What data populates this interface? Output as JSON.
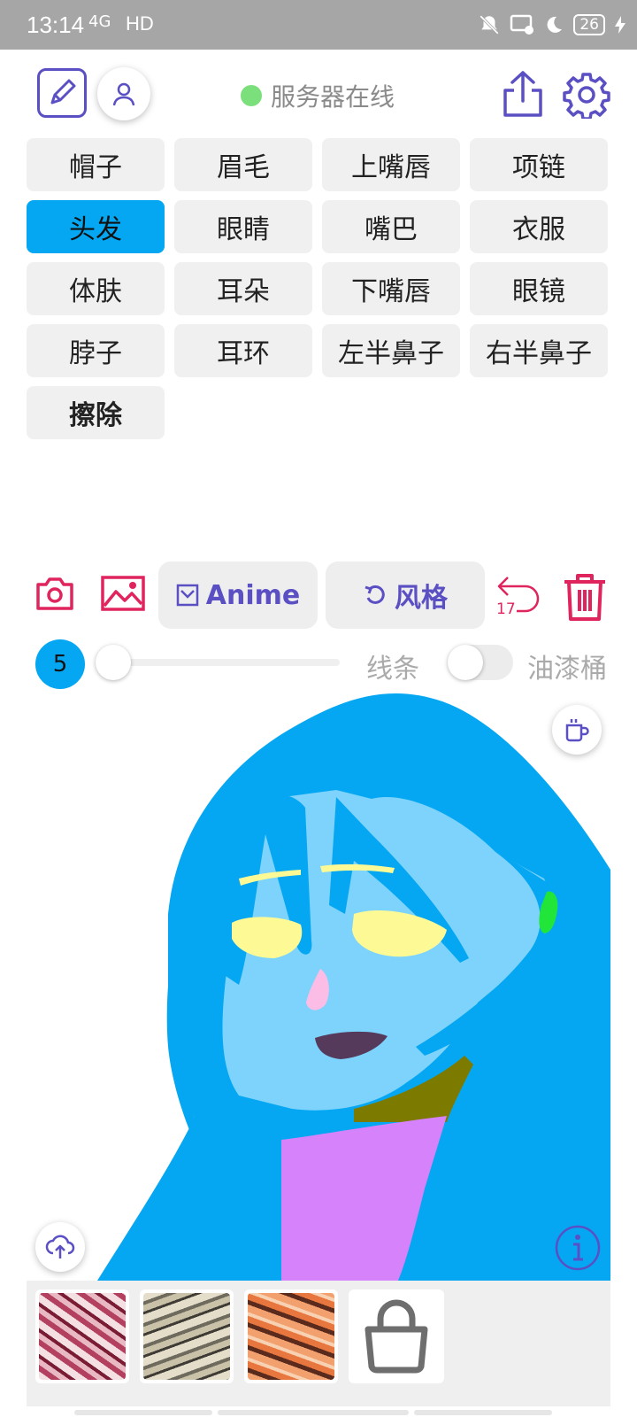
{
  "status_bar": {
    "time": "13:14",
    "network": "4G",
    "hd": "HD",
    "battery": "26"
  },
  "header": {
    "server_status": "服务器在线",
    "server_status_color": "#7be07b"
  },
  "categories": [
    {
      "label": "帽子"
    },
    {
      "label": "眉毛"
    },
    {
      "label": "上嘴唇"
    },
    {
      "label": "项链"
    },
    {
      "label": "头发",
      "selected": true
    },
    {
      "label": "眼睛"
    },
    {
      "label": "嘴巴"
    },
    {
      "label": "衣服"
    },
    {
      "label": "体肤"
    },
    {
      "label": "耳朵"
    },
    {
      "label": "下嘴唇"
    },
    {
      "label": "眼镜"
    },
    {
      "label": "脖子"
    },
    {
      "label": "耳环"
    },
    {
      "label": "左半鼻子"
    },
    {
      "label": "右半鼻子"
    },
    {
      "label": "擦除"
    }
  ],
  "toolbar": {
    "model_label": "Anime",
    "style_label": "风格",
    "undo_count": "17"
  },
  "brush": {
    "size": "5",
    "line_label": "线条",
    "bucket_label": "油漆桶",
    "bucket_enabled": false
  },
  "colors": {
    "accent": "#5b4fc4",
    "selected": "#05a7f2",
    "danger": "#e0245e",
    "hair": "#05a7f2",
    "skin": "#7dd3fb",
    "eyes": "#fdfa95",
    "mouth": "#553a5c",
    "nose": "#fbbde6",
    "neck": "#7c7b00",
    "clothes": "#d683fb",
    "earring": "#22e53a"
  },
  "icons": {
    "edit": "edit-icon",
    "user": "user-icon",
    "share": "share-icon",
    "settings": "gear-icon",
    "camera": "camera-icon",
    "image": "image-icon",
    "undo": "undo-icon",
    "trash": "trash-icon",
    "cup": "coffee-cup-icon",
    "upload": "cloud-upload-icon",
    "info": "info-icon",
    "lock": "lock-icon"
  }
}
